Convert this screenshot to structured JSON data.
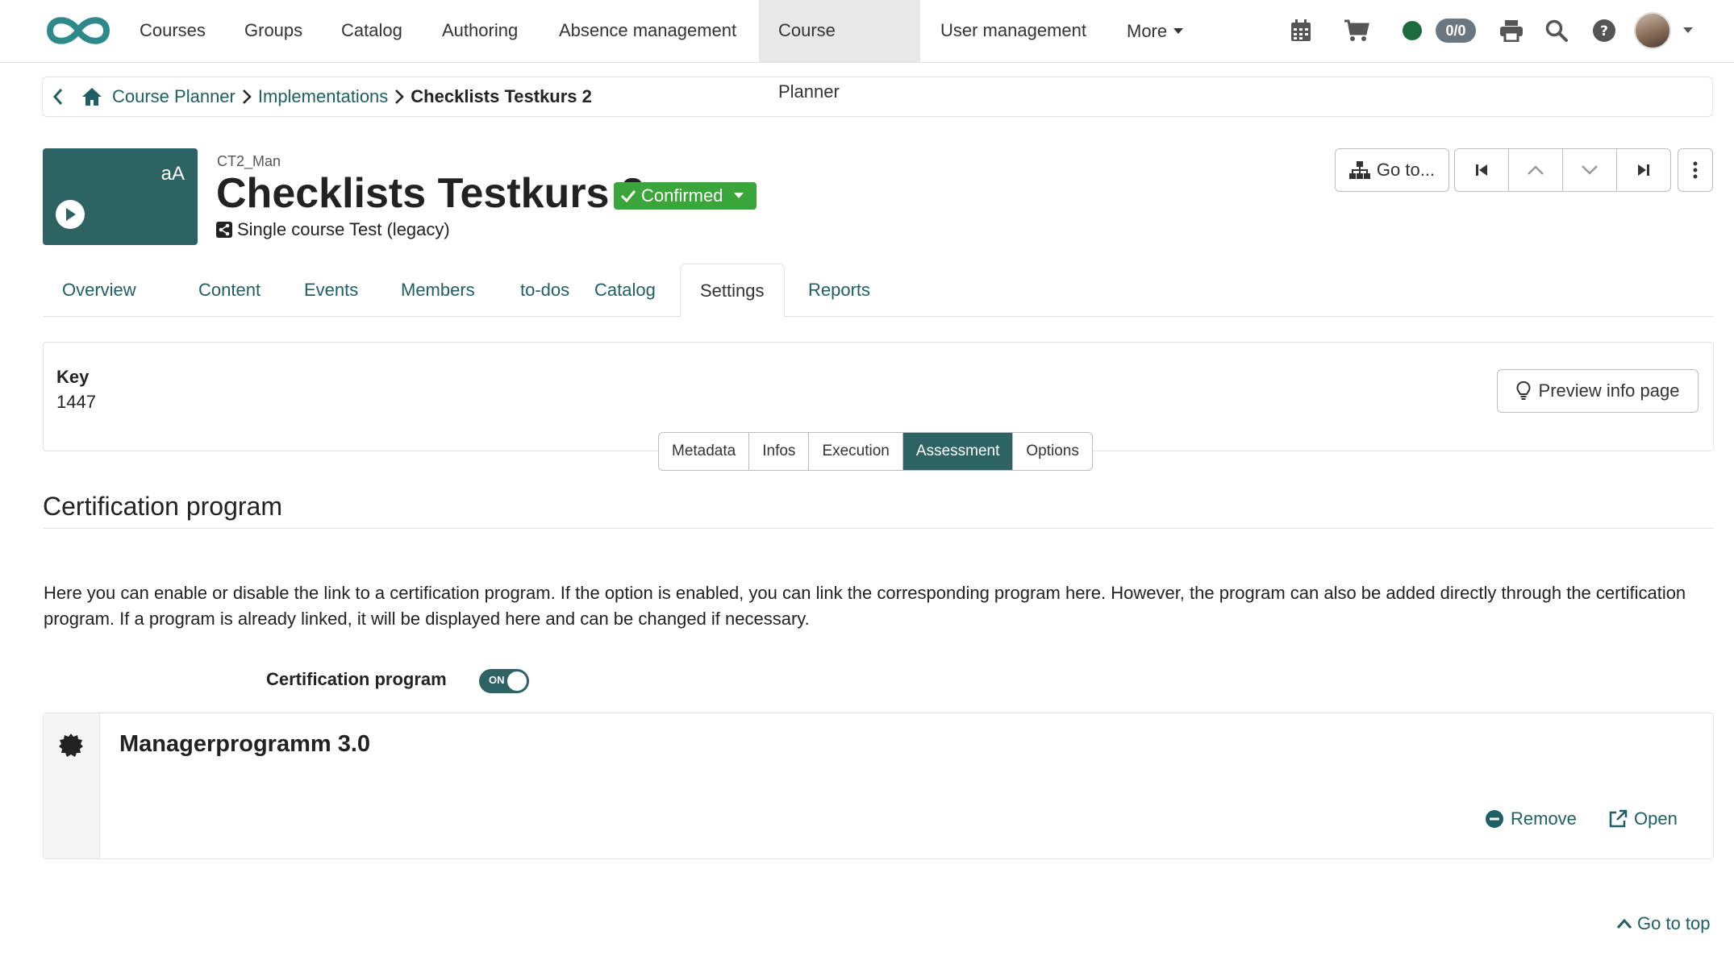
{
  "nav": {
    "items": [
      "Courses",
      "Groups",
      "Catalog",
      "Authoring",
      "Absence management",
      "Course Planner",
      "User management",
      "More"
    ],
    "active": "Course Planner",
    "status_count": "0/0",
    "icons": [
      "calendar-icon",
      "cart-icon",
      "status-dot",
      "print-icon",
      "search-icon",
      "help-icon",
      "avatar"
    ]
  },
  "breadcrumb": {
    "items": [
      "Course Planner",
      "Implementations",
      "Checklists Testkurs 2"
    ]
  },
  "header": {
    "tile_text": "aA",
    "external_ref": "CT2_Man",
    "title": "Checklists Testkurs 2",
    "status": "Confirmed",
    "type": "Single course Test (legacy)",
    "goto_label": "Go to..."
  },
  "tabs": [
    "Overview",
    "Content",
    "Events",
    "Members",
    "to-dos",
    "Catalog",
    "Settings",
    "Reports"
  ],
  "active_tab": "Settings",
  "key_panel": {
    "label": "Key",
    "value": "1447",
    "preview_label": "Preview info page"
  },
  "subtabs": [
    "Metadata",
    "Infos",
    "Execution",
    "Assessment",
    "Options"
  ],
  "active_subtab": "Assessment",
  "section": {
    "title": "Certification program",
    "description": "Here you can enable or disable the link to a certification program. If the option is enabled, you can link the corresponding program here. However, the program can also be added directly through the certification program. If a program is already linked, it will be displayed here and can be changed if necessary.",
    "toggle_label": "Certification program",
    "toggle_state": "ON"
  },
  "program": {
    "name": "Managerprogramm 3.0",
    "remove_label": "Remove",
    "open_label": "Open"
  },
  "footer": {
    "go_top_label": "Go to top"
  },
  "colors": {
    "accent": "#2e6364",
    "link": "#1f5f63",
    "status_green": "#3aa53a"
  }
}
